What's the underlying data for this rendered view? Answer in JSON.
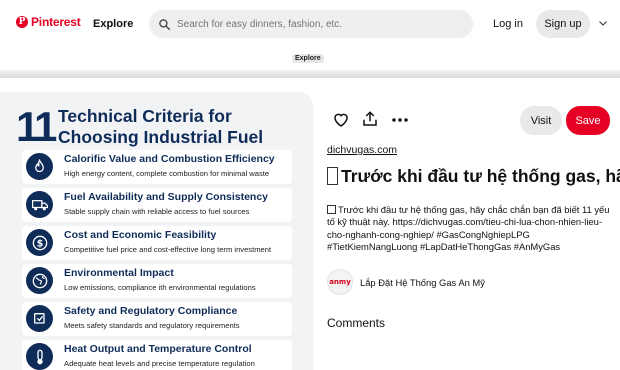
{
  "header": {
    "logo_text": "Pinterest",
    "logo_mark": "P",
    "explore": "Explore",
    "search_placeholder": "Search for easy dinners, fashion, etc.",
    "login": "Log in",
    "signup": "Sign up",
    "icons": {
      "search": "search-icon",
      "chevron": "chevron-down-icon"
    }
  },
  "tooltip": "Explore",
  "infographic": {
    "number": "11",
    "title": "Technical Criteria for Choosing Industrial Fuel",
    "criteria": [
      {
        "title": "Calorific Value and Combustion Efficiency",
        "desc": "High energy content, complete combustion for minimal waste",
        "icon": "flame-icon"
      },
      {
        "title": "Fuel Availability and Supply Consistency",
        "desc": "Stable supply chain with reliable access to fuel sources",
        "icon": "truck-icon"
      },
      {
        "title": "Cost and Economic Feasibility",
        "desc": "Competitive fuel price and cost-effective long term investment",
        "icon": "dollar-icon"
      },
      {
        "title": "Environmental Impact",
        "desc": "Low emissions, compliance  ith environmental regulations",
        "icon": "globe-icon"
      },
      {
        "title": "Safety and Regulatory Compliance",
        "desc": "Meets safety standards and regulatory requirements",
        "icon": "shield-icon"
      },
      {
        "title": "Heat Output and Temperature Control",
        "desc": "Adequate heat levels and precise temperature regulation",
        "icon": "thermometer-icon"
      }
    ],
    "accent_color": "#0f2c59"
  },
  "pin": {
    "visit": "Visit",
    "save": "Save",
    "source": "dichvugas.com",
    "title": "Trước khi đầu tư hệ thống gas, hãy",
    "description": "Trước khi đầu tư hệ thống gas, hãy chắc chắn bạn đã biết 11 yếu tố kỹ thuật này. https://dichvugas.com/tieu-chi-lua-chon-nhien-lieu-cho-nghanh-cong-nghiep/ #GasCongNghiepLPG #TietKiemNangLuong #LapDatHeThongGas #AnMyGas",
    "creator_avatar": "anmy",
    "creator_name": "Lắp Đặt Hệ Thống Gas An Mỹ",
    "comments": "Comments",
    "brand_color": "#e60023"
  }
}
